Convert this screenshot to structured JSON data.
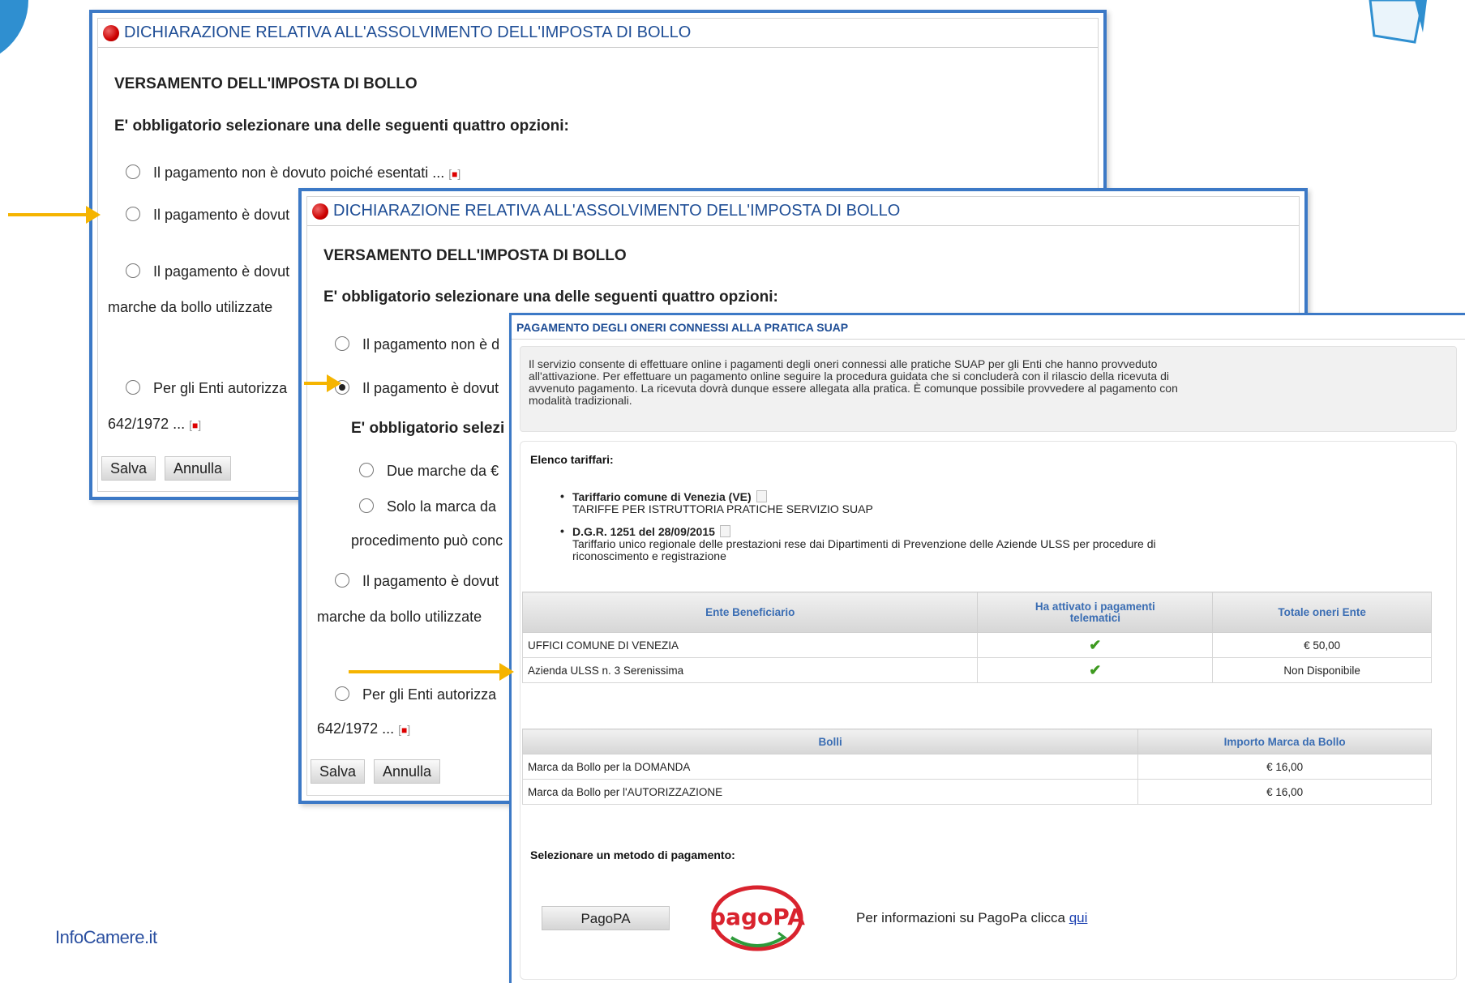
{
  "panel_back": {
    "header": "DICHIARAZIONE RELATIVA ALL'ASSOLVIMENTO DELL'IMPOSTA DI BOLLO",
    "section": "VERSAMENTO DELL'IMPOSTA DI BOLLO",
    "instruction": "E' obbligatorio selezionare una delle seguenti quattro opzioni:",
    "options": [
      "Il pagamento non è dovuto poiché esentati ...",
      "Il pagamento è dovut",
      "Il pagamento è dovut",
      "Per gli Enti autorizza"
    ],
    "line_marche": "marche da bollo utilizzate",
    "line_642": "642/1972 ...",
    "save": "Salva",
    "cancel": "Annulla"
  },
  "panel_mid": {
    "header": "DICHIARAZIONE RELATIVA ALL'ASSOLVIMENTO DELL'IMPOSTA DI BOLLO",
    "section": "VERSAMENTO DELL'IMPOSTA DI BOLLO",
    "instruction": "E' obbligatorio selezionare una delle seguenti quattro opzioni:",
    "opt1": "Il pagamento non è d",
    "opt2": "Il pagamento è dovut",
    "sub_instruction": "E' obbligatorio selezi",
    "sub_opt1": "Due marche da €",
    "sub_opt2": "Solo la marca da",
    "procedimento": "procedimento può conc",
    "opt3": "Il pagamento è dovut",
    "line_marche": "marche da bollo utilizzate",
    "opt4": "Per gli Enti autorizza",
    "line_642": "642/1972 ...",
    "save": "Salva",
    "cancel": "Annulla"
  },
  "panel_front": {
    "title": "PAGAMENTO DEGLI ONERI CONNESSI ALLA PRATICA SUAP",
    "intro_lines": [
      "Il servizio consente di effettuare online i pagamenti degli oneri connessi alle pratiche SUAP per gli Enti che hanno provveduto",
      "all'attivazione. Per effettuare un pagamento online seguire la procedura guidata che si concluderà con il rilascio della ricevuta di",
      "avvenuto pagamento. La ricevuta dovrà dunque essere allegata alla pratica. È comunque possibile provvedere al pagamento con",
      "modalità tradizionali."
    ],
    "elenco_label": "Elenco tariffari:",
    "tariffari": [
      {
        "title": "Tariffario comune di Venezia (VE)",
        "desc": "TARIFFE PER ISTRUTTORIA PRATICHE SERVIZIO SUAP"
      },
      {
        "title": "D.G.R. 1251 del 28/09/2015",
        "desc": "Tariffario unico regionale delle prestazioni rese dai Dipartimenti di Prevenzione delle Aziende ULSS per procedure di",
        "desc2": "riconoscimento e registrazione"
      }
    ],
    "enti_table": {
      "headers": [
        "Ente Beneficiario",
        "Ha attivato i pagamenti",
        "telematici",
        "Totale oneri Ente"
      ],
      "rows": [
        {
          "ente": "UFFICI COMUNE DI VENEZIA",
          "attivato": "✔",
          "totale": "€ 50,00"
        },
        {
          "ente": "Azienda ULSS n. 3 Serenissima",
          "attivato": "✔",
          "totale": "Non Disponibile"
        }
      ]
    },
    "bolli_table": {
      "headers": [
        "Bolli",
        "Importo Marca da Bollo"
      ],
      "rows": [
        {
          "bollo": "Marca da Bollo per la DOMANDA",
          "importo": "€ 16,00"
        },
        {
          "bollo": "Marca da Bollo per l'AUTORIZZAZIONE",
          "importo": "€ 16,00"
        }
      ]
    },
    "metodo_label": "Selezionare un metodo di pagamento:",
    "pagopa_button": "PagoPA",
    "logo_text": "pagoPA",
    "info_text": "Per informazioni su PagoPa clicca",
    "info_link": "qui"
  },
  "footer": "InfoCamere.it",
  "colors": {
    "panel_border": "#3c79c6",
    "arrow": "#f5b400",
    "title_blue": "#1f4e96",
    "check_green": "#3d9a1f",
    "pagopa_red": "#d9232e"
  }
}
